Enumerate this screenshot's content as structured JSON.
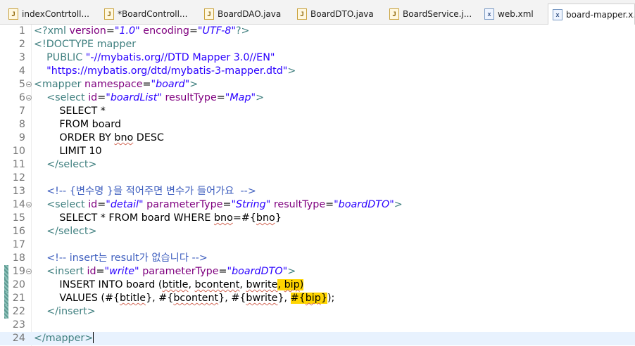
{
  "tabs": [
    {
      "label": "indexContrtoll...",
      "icon": "java-file-icon",
      "active": false
    },
    {
      "label": "*BoardControll...",
      "icon": "java-file-icon",
      "active": false
    },
    {
      "label": "BoardDAO.java",
      "icon": "java-file-icon",
      "active": false
    },
    {
      "label": "BoardDTO.java",
      "icon": "java-file-icon",
      "active": false
    },
    {
      "label": "BoardService.j...",
      "icon": "java-file-icon",
      "active": false
    },
    {
      "label": "web.xml",
      "icon": "xml-file-icon",
      "active": false
    },
    {
      "label": "board-mapper.x...",
      "icon": "xml-file-icon",
      "active": true
    }
  ],
  "icon_glyphs": {
    "java": "J",
    "xml": "x"
  },
  "editor": {
    "current_line": 24,
    "lines": [
      {
        "n": "1",
        "segs": [
          [
            "t",
            "<?xml "
          ],
          [
            "a",
            "version"
          ],
          [
            "p",
            "="
          ],
          [
            "v",
            "\"1.0\""
          ],
          [
            "p",
            " "
          ],
          [
            "a",
            "encoding"
          ],
          [
            "p",
            "="
          ],
          [
            "v",
            "\"UTF-8\""
          ],
          [
            "t",
            "?>"
          ]
        ]
      },
      {
        "n": "2",
        "segs": [
          [
            "t",
            "<!DOCTYPE mapper"
          ]
        ]
      },
      {
        "n": "3",
        "segs": [
          [
            "t",
            "    PUBLIC "
          ],
          [
            "s",
            "\"-//mybatis.org//DTD Mapper 3.0//EN\""
          ]
        ]
      },
      {
        "n": "4",
        "segs": [
          [
            "s",
            "    \"https://mybatis.org/dtd/mybatis-3-mapper.dtd\""
          ],
          [
            "t",
            ">"
          ]
        ]
      },
      {
        "n": "5",
        "fold": true,
        "segs": [
          [
            "t",
            "<mapper "
          ],
          [
            "a",
            "namespace"
          ],
          [
            "p",
            "="
          ],
          [
            "v",
            "\"board\""
          ],
          [
            "t",
            ">"
          ]
        ]
      },
      {
        "n": "6",
        "fold": true,
        "segs": [
          [
            "p",
            "    "
          ],
          [
            "t",
            "<select "
          ],
          [
            "a",
            "id"
          ],
          [
            "p",
            "="
          ],
          [
            "v",
            "\"boardList\""
          ],
          [
            "p",
            " "
          ],
          [
            "a",
            "resultType"
          ],
          [
            "p",
            "="
          ],
          [
            "v",
            "\"Map\""
          ],
          [
            "t",
            ">"
          ]
        ]
      },
      {
        "n": "7",
        "segs": [
          [
            "p",
            "        SELECT *"
          ]
        ]
      },
      {
        "n": "8",
        "segs": [
          [
            "p",
            "        FROM board"
          ]
        ]
      },
      {
        "n": "9",
        "segs": [
          [
            "p",
            "        ORDER BY "
          ],
          [
            "sq",
            "bno"
          ],
          [
            "p",
            " DESC"
          ]
        ]
      },
      {
        "n": "10",
        "segs": [
          [
            "p",
            "        LIMIT 10"
          ]
        ]
      },
      {
        "n": "11",
        "segs": [
          [
            "p",
            "    "
          ],
          [
            "t",
            "</select>"
          ]
        ]
      },
      {
        "n": "12",
        "segs": []
      },
      {
        "n": "13",
        "segs": [
          [
            "p",
            "    "
          ],
          [
            "c",
            "<!-- {변수명 }을 적어주면 변수가 들어가요  -->"
          ]
        ]
      },
      {
        "n": "14",
        "fold": true,
        "segs": [
          [
            "p",
            "    "
          ],
          [
            "t",
            "<select "
          ],
          [
            "a",
            "id"
          ],
          [
            "p",
            "="
          ],
          [
            "v",
            "\"detail\""
          ],
          [
            "p",
            " "
          ],
          [
            "a",
            "parameterType"
          ],
          [
            "p",
            "="
          ],
          [
            "v",
            "\"String\""
          ],
          [
            "p",
            " "
          ],
          [
            "a",
            "resultType"
          ],
          [
            "p",
            "="
          ],
          [
            "v",
            "\"boardDTO\""
          ],
          [
            "t",
            ">"
          ]
        ]
      },
      {
        "n": "15",
        "segs": [
          [
            "p",
            "        SELECT * FROM board WHERE "
          ],
          [
            "sq",
            "bno"
          ],
          [
            "p",
            "=#{"
          ],
          [
            "sq",
            "bno"
          ],
          [
            "p",
            "}"
          ]
        ]
      },
      {
        "n": "16",
        "segs": [
          [
            "p",
            "    "
          ],
          [
            "t",
            "</select>"
          ]
        ]
      },
      {
        "n": "17",
        "segs": []
      },
      {
        "n": "18",
        "segs": [
          [
            "p",
            "    "
          ],
          [
            "c",
            "<!-- insert는 result가 없습니다 -->"
          ]
        ]
      },
      {
        "n": "19",
        "fold": true,
        "mark": true,
        "segs": [
          [
            "p",
            "    "
          ],
          [
            "t",
            "<insert "
          ],
          [
            "a",
            "id"
          ],
          [
            "p",
            "="
          ],
          [
            "v",
            "\"write\""
          ],
          [
            "p",
            " "
          ],
          [
            "a",
            "parameterType"
          ],
          [
            "p",
            "="
          ],
          [
            "v",
            "\"boardDTO\""
          ],
          [
            "t",
            ">"
          ]
        ]
      },
      {
        "n": "20",
        "mark": true,
        "segs": [
          [
            "p",
            "        INSERT INTO board ("
          ],
          [
            "sq",
            "btitle"
          ],
          [
            "p",
            ", "
          ],
          [
            "sq",
            "bcontent"
          ],
          [
            "p",
            ", "
          ],
          [
            "sq",
            "bwrite"
          ],
          [
            "hl",
            ", "
          ],
          [
            "hlsq",
            "bip"
          ],
          [
            "hl",
            ")"
          ]
        ]
      },
      {
        "n": "21",
        "mark": true,
        "segs": [
          [
            "p",
            "        VALUES (#{"
          ],
          [
            "sq",
            "btitle"
          ],
          [
            "p",
            "}, #{"
          ],
          [
            "sq",
            "bcontent"
          ],
          [
            "p",
            "}, #{"
          ],
          [
            "sq",
            "bwrite"
          ],
          [
            "p",
            "}, "
          ],
          [
            "hl",
            "#{"
          ],
          [
            "hlsq",
            "bip"
          ],
          [
            "hl",
            "}"
          ],
          [
            "p",
            ");"
          ]
        ]
      },
      {
        "n": "22",
        "mark": true,
        "segs": [
          [
            "p",
            "    "
          ],
          [
            "t",
            "</insert>"
          ]
        ]
      },
      {
        "n": "23",
        "segs": []
      },
      {
        "n": "24",
        "caret": true,
        "segs": [
          [
            "t",
            "</mapper>"
          ]
        ]
      }
    ]
  }
}
